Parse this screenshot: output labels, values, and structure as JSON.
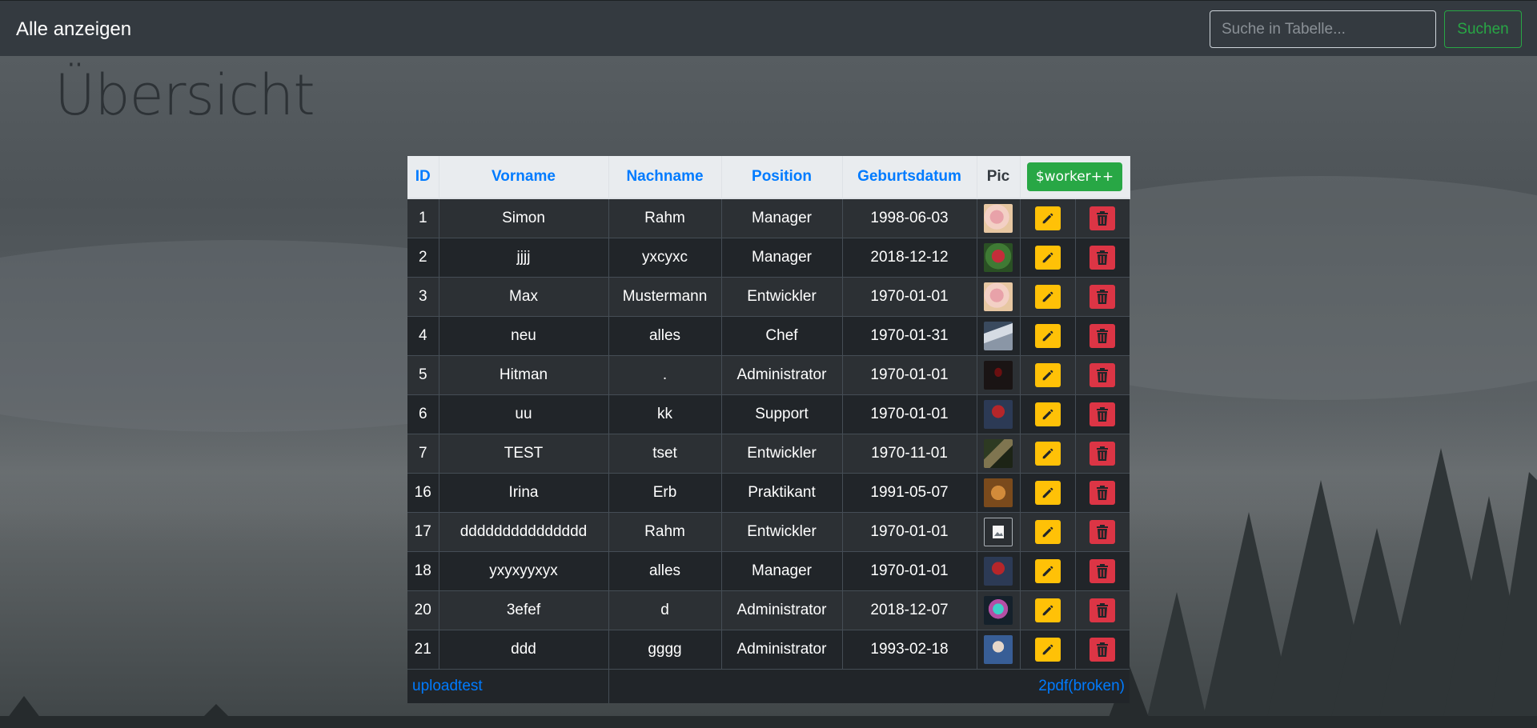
{
  "nav": {
    "brand": "Alle anzeigen",
    "search_placeholder": "Suche in Tabelle...",
    "search_button": "Suchen"
  },
  "page": {
    "title": "Übersicht"
  },
  "table": {
    "headers": {
      "id": "ID",
      "vorname": "Vorname",
      "nachname": "Nachname",
      "position": "Position",
      "geburtsdatum": "Geburtsdatum",
      "pic": "Pic",
      "add_button": "$worker++"
    },
    "rows": [
      {
        "id": "1",
        "vorname": "Simon",
        "nachname": "Rahm",
        "position": "Manager",
        "geburtsdatum": "1998-06-03",
        "pic": "flower-pink"
      },
      {
        "id": "2",
        "vorname": "jjjj",
        "nachname": "yxcyxc",
        "position": "Manager",
        "geburtsdatum": "2018-12-12",
        "pic": "flower-red"
      },
      {
        "id": "3",
        "vorname": "Max",
        "nachname": "Mustermann",
        "position": "Entwickler",
        "geburtsdatum": "1970-01-01",
        "pic": "flower-pink"
      },
      {
        "id": "4",
        "vorname": "neu",
        "nachname": "alles",
        "position": "Chef",
        "geburtsdatum": "1970-01-31",
        "pic": "wing-gray"
      },
      {
        "id": "5",
        "vorname": "Hitman",
        "nachname": ".",
        "position": "Administrator",
        "geburtsdatum": "1970-01-01",
        "pic": "dark-figure"
      },
      {
        "id": "6",
        "vorname": "uu",
        "nachname": "kk",
        "position": "Support",
        "geburtsdatum": "1970-01-01",
        "pic": "red-hero"
      },
      {
        "id": "7",
        "vorname": "TEST",
        "nachname": "tset",
        "position": "Entwickler",
        "geburtsdatum": "1970-11-01",
        "pic": "soldier"
      },
      {
        "id": "16",
        "vorname": "Irina",
        "nachname": "Erb",
        "position": "Praktikant",
        "geburtsdatum": "1991-05-07",
        "pic": "orange-creature"
      },
      {
        "id": "17",
        "vorname": "ddddddddddddddd",
        "nachname": "Rahm",
        "position": "Entwickler",
        "geburtsdatum": "1970-01-01",
        "pic": "broken-image"
      },
      {
        "id": "18",
        "vorname": "yxyxyyxyx",
        "nachname": "alles",
        "position": "Manager",
        "geburtsdatum": "1970-01-01",
        "pic": "red-hero"
      },
      {
        "id": "20",
        "vorname": "3efef",
        "nachname": "d",
        "position": "Administrator",
        "geburtsdatum": "2018-12-07",
        "pic": "cyan-figure"
      },
      {
        "id": "21",
        "vorname": "ddd",
        "nachname": "gggg",
        "position": "Administrator",
        "geburtsdatum": "1993-02-18",
        "pic": "portrait-blue"
      }
    ],
    "footer": {
      "left_link": "uploadtest",
      "right_link": "2pdf(broken)"
    }
  },
  "colors": {
    "navbar": "#343a40",
    "link": "#007bff",
    "success": "#28a745",
    "edit": "#ffc107",
    "delete": "#dc3545",
    "table_dark": "#212529"
  }
}
